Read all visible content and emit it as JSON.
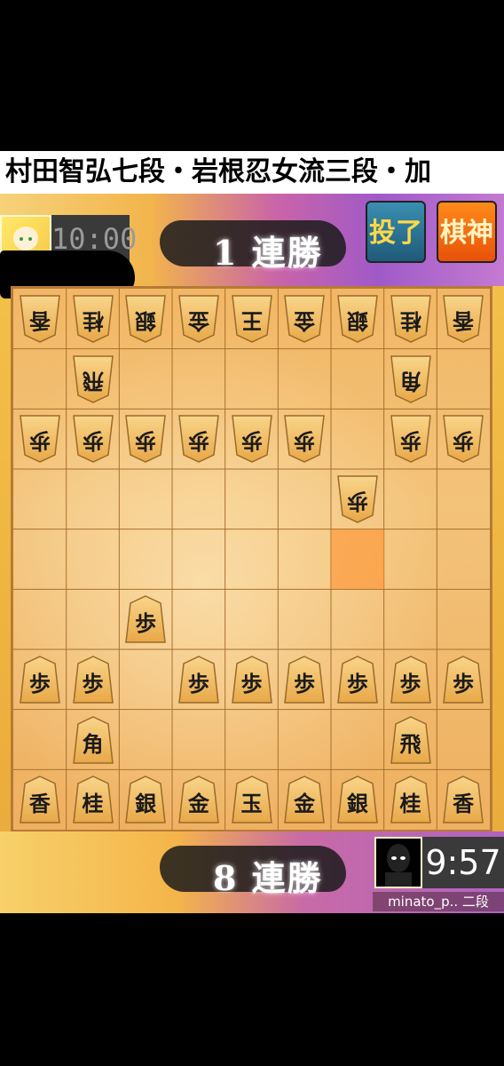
{
  "banner": {
    "text": "村田智弘七段・岩根忍女流三段・加"
  },
  "top": {
    "clock": "10:00",
    "streak": "1 連勝",
    "resign_label": "投了",
    "kishin_label": "棋神"
  },
  "bottom": {
    "clock": "9:57",
    "streak": "8 連勝",
    "player_name": "minato_p.. 二段"
  },
  "board": {
    "files": 9,
    "ranks": 9,
    "last_move_square": [
      6,
      4
    ],
    "pieces": [
      {
        "label": "香",
        "col": 0,
        "row": 0,
        "owner": "gote"
      },
      {
        "label": "桂",
        "col": 1,
        "row": 0,
        "owner": "gote"
      },
      {
        "label": "銀",
        "col": 2,
        "row": 0,
        "owner": "gote"
      },
      {
        "label": "金",
        "col": 3,
        "row": 0,
        "owner": "gote"
      },
      {
        "label": "王",
        "col": 4,
        "row": 0,
        "owner": "gote"
      },
      {
        "label": "金",
        "col": 5,
        "row": 0,
        "owner": "gote"
      },
      {
        "label": "銀",
        "col": 6,
        "row": 0,
        "owner": "gote"
      },
      {
        "label": "桂",
        "col": 7,
        "row": 0,
        "owner": "gote"
      },
      {
        "label": "香",
        "col": 8,
        "row": 0,
        "owner": "gote"
      },
      {
        "label": "飛",
        "col": 1,
        "row": 1,
        "owner": "gote"
      },
      {
        "label": "角",
        "col": 7,
        "row": 1,
        "owner": "gote"
      },
      {
        "label": "歩",
        "col": 0,
        "row": 2,
        "owner": "gote"
      },
      {
        "label": "歩",
        "col": 1,
        "row": 2,
        "owner": "gote"
      },
      {
        "label": "歩",
        "col": 2,
        "row": 2,
        "owner": "gote"
      },
      {
        "label": "歩",
        "col": 3,
        "row": 2,
        "owner": "gote"
      },
      {
        "label": "歩",
        "col": 4,
        "row": 2,
        "owner": "gote"
      },
      {
        "label": "歩",
        "col": 5,
        "row": 2,
        "owner": "gote"
      },
      {
        "label": "歩",
        "col": 7,
        "row": 2,
        "owner": "gote"
      },
      {
        "label": "歩",
        "col": 8,
        "row": 2,
        "owner": "gote"
      },
      {
        "label": "歩",
        "col": 6,
        "row": 3,
        "owner": "gote"
      },
      {
        "label": "歩",
        "col": 2,
        "row": 5,
        "owner": "sente"
      },
      {
        "label": "歩",
        "col": 0,
        "row": 6,
        "owner": "sente"
      },
      {
        "label": "歩",
        "col": 1,
        "row": 6,
        "owner": "sente"
      },
      {
        "label": "歩",
        "col": 3,
        "row": 6,
        "owner": "sente"
      },
      {
        "label": "歩",
        "col": 4,
        "row": 6,
        "owner": "sente"
      },
      {
        "label": "歩",
        "col": 5,
        "row": 6,
        "owner": "sente"
      },
      {
        "label": "歩",
        "col": 6,
        "row": 6,
        "owner": "sente"
      },
      {
        "label": "歩",
        "col": 7,
        "row": 6,
        "owner": "sente"
      },
      {
        "label": "歩",
        "col": 8,
        "row": 6,
        "owner": "sente"
      },
      {
        "label": "角",
        "col": 1,
        "row": 7,
        "owner": "sente"
      },
      {
        "label": "飛",
        "col": 7,
        "row": 7,
        "owner": "sente"
      },
      {
        "label": "香",
        "col": 0,
        "row": 8,
        "owner": "sente"
      },
      {
        "label": "桂",
        "col": 1,
        "row": 8,
        "owner": "sente"
      },
      {
        "label": "銀",
        "col": 2,
        "row": 8,
        "owner": "sente"
      },
      {
        "label": "金",
        "col": 3,
        "row": 8,
        "owner": "sente"
      },
      {
        "label": "玉",
        "col": 4,
        "row": 8,
        "owner": "sente"
      },
      {
        "label": "金",
        "col": 5,
        "row": 8,
        "owner": "sente"
      },
      {
        "label": "銀",
        "col": 6,
        "row": 8,
        "owner": "sente"
      },
      {
        "label": "桂",
        "col": 7,
        "row": 8,
        "owner": "sente"
      },
      {
        "label": "香",
        "col": 8,
        "row": 8,
        "owner": "sente"
      }
    ]
  },
  "colors": {
    "board": "#f2b765",
    "highlight": "#ff8c28",
    "piece": "#f5c56a"
  }
}
